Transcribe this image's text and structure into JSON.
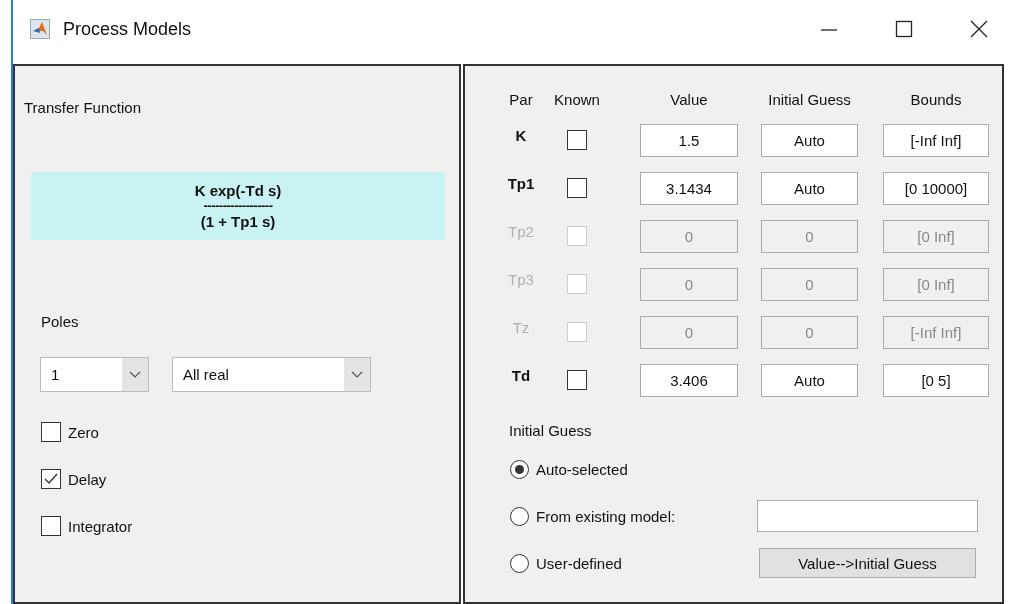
{
  "window": {
    "title": "Process Models"
  },
  "transfer_function": {
    "label": "Transfer Function",
    "numerator": "K exp(-Td s)",
    "divider": "------------------",
    "denominator": "(1 + Tp1 s)"
  },
  "poles": {
    "label": "Poles",
    "count": "1",
    "type": "All real"
  },
  "options": [
    {
      "label": "Zero",
      "checked": false
    },
    {
      "label": "Delay",
      "checked": true
    },
    {
      "label": "Integrator",
      "checked": false
    }
  ],
  "parameters": {
    "columns": [
      "Par",
      "Known",
      "Value",
      "Initial Guess",
      "Bounds"
    ],
    "rows": [
      {
        "par": "K",
        "known": false,
        "disabled": false,
        "value": "1.5",
        "initial_guess": "Auto",
        "bounds": "[-Inf Inf]"
      },
      {
        "par": "Tp1",
        "known": false,
        "disabled": false,
        "value": "3.1434",
        "initial_guess": "Auto",
        "bounds": "[0 10000]"
      },
      {
        "par": "Tp2",
        "known": false,
        "disabled": true,
        "value": "0",
        "initial_guess": "0",
        "bounds": "[0 Inf]"
      },
      {
        "par": "Tp3",
        "known": false,
        "disabled": true,
        "value": "0",
        "initial_guess": "0",
        "bounds": "[0 Inf]"
      },
      {
        "par": "Tz",
        "known": false,
        "disabled": true,
        "value": "0",
        "initial_guess": "0",
        "bounds": "[-Inf Inf]"
      },
      {
        "par": "Td",
        "known": false,
        "disabled": false,
        "value": "3.406",
        "initial_guess": "Auto",
        "bounds": "[0 5]"
      }
    ]
  },
  "initial_guess": {
    "label": "Initial Guess",
    "options": [
      {
        "label": "Auto-selected",
        "selected": true,
        "kind": "plain"
      },
      {
        "label": "From existing model:",
        "selected": false,
        "kind": "field"
      },
      {
        "label": "User-defined",
        "selected": false,
        "kind": "button",
        "button": "Value-->Initial Guess"
      }
    ]
  }
}
